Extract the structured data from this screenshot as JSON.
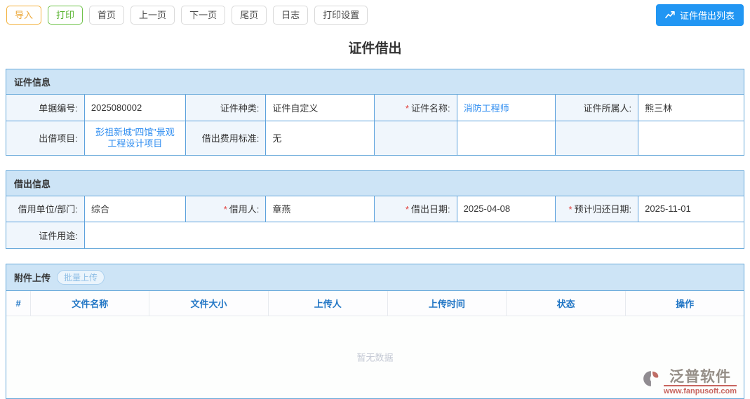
{
  "marks": {
    "required": "*"
  },
  "toolbar": {
    "buttons": [
      {
        "label": "导入",
        "style": "warning"
      },
      {
        "label": "打印",
        "style": "success"
      },
      {
        "label": "首页",
        "style": "default"
      },
      {
        "label": "上一页",
        "style": "default"
      },
      {
        "label": "下一页",
        "style": "default"
      },
      {
        "label": "尾页",
        "style": "default"
      },
      {
        "label": "日志",
        "style": "default"
      },
      {
        "label": "打印设置",
        "style": "default"
      }
    ],
    "list_button": {
      "label": "证件借出列表",
      "icon": "trend-line-icon"
    }
  },
  "page_title": "证件借出",
  "cert_info": {
    "title": "证件信息",
    "rows": [
      {
        "cells": [
          {
            "label": "单据编号:",
            "value": "2025080002"
          },
          {
            "label": "证件种类:",
            "value": "证件自定义"
          },
          {
            "label": "证件名称:",
            "required": true,
            "value": "消防工程师",
            "link": true
          },
          {
            "label": "证件所属人:",
            "value": "熊三林"
          }
        ]
      },
      {
        "cells": [
          {
            "label": "出借项目:",
            "value": "彭祖新城“四馆”景观工程设计项目",
            "link": true
          },
          {
            "label": "借出费用标准:",
            "value": "无"
          },
          {
            "label": "",
            "value": ""
          },
          {
            "label": "",
            "value": ""
          }
        ]
      }
    ]
  },
  "lend_info": {
    "title": "借出信息",
    "rows": [
      {
        "cells": [
          {
            "label": "借用单位/部门:",
            "value": "综合"
          },
          {
            "label": "借用人:",
            "required": true,
            "value": "章燕"
          },
          {
            "label": "借出日期:",
            "required": true,
            "value": "2025-04-08"
          },
          {
            "label": "预计归还日期:",
            "required": true,
            "value": "2025-11-01"
          }
        ]
      },
      {
        "cells": [
          {
            "label": "证件用途:",
            "value": ""
          }
        ]
      }
    ]
  },
  "attachments": {
    "title": "附件上传",
    "batch_upload_label": "批量上传",
    "headers": [
      "#",
      "文件名称",
      "文件大小",
      "上传人",
      "上传时间",
      "状态",
      "操作"
    ],
    "rows": [],
    "empty_text": "暂无数据"
  },
  "footer_logo": {
    "name": "泛普软件",
    "url": "www.fanpusoft.com"
  },
  "colors": {
    "accent_blue": "#2196f3",
    "import_orange": "#eda93b",
    "print_green": "#57b32e",
    "panel_border": "#68a9da",
    "panel_header_bg": "#cde4f6",
    "label_cell_bg": "#f0f6fc",
    "link_blue": "#2d8cf0",
    "required_red": "#e23c39",
    "att_header_blue": "#2176c5",
    "empty_text_gray": "#c5cad5",
    "logo_gray": "#847b73",
    "logo_red": "#bf4b44"
  }
}
